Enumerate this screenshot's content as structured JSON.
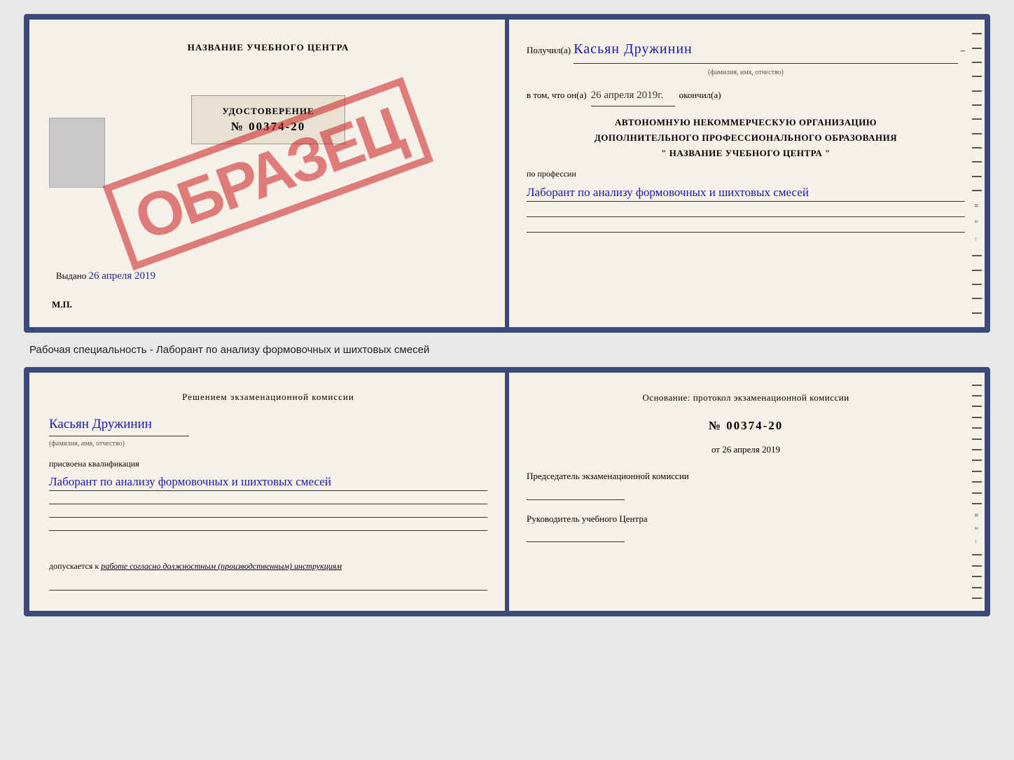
{
  "top_card": {
    "left": {
      "title": "НАЗВАНИЕ УЧЕБНОГО ЦЕНТРА",
      "stamp": "ОБРАЗЕЦ",
      "udost_label": "УДОСТОВЕРЕНИЕ",
      "udost_number": "№ 00374-20",
      "vydano_label": "Выдано",
      "vydano_date": "26 апреля 2019",
      "mp_label": "М.П."
    },
    "right": {
      "poluchil_label": "Получил(а)",
      "fio_name": "Касьян Дружинин",
      "fio_sub": "(фамилия, имя, отчество)",
      "vtom_label": "в том, что он(а)",
      "vtom_date": "26 апреля 2019г.",
      "okonchil_label": "окончил(а)",
      "org_line1": "АВТОНОМНУЮ НЕКОММЕРЧЕСКУЮ ОРГАНИЗАЦИЮ",
      "org_line2": "ДОПОЛНИТЕЛЬНОГО ПРОФЕССИОНАЛЬНОГО ОБРАЗОВАНИЯ",
      "org_name": "\" НАЗВАНИЕ УЧЕБНОГО ЦЕНТРА \"",
      "prof_label": "по профессии",
      "prof_handwritten": "Лаборант по анализу формовочных и шихтовых смесей"
    }
  },
  "specialty_label": "Рабочая специальность - Лаборант по анализу формовочных и шихтовых смесей",
  "bottom_card": {
    "left": {
      "heading": "Решением экзаменационной комиссии",
      "fio": "Касьян Дружинин",
      "fio_sub": "(фамилия, имя, отчество)",
      "prisvoena": "присвоена квалификация",
      "kvali": "Лаборант по анализу формовочных и шихтовых смесей",
      "dopusk_label": "допускается к",
      "dopusk_text": "работе согласно должностным (производственным) инструкциям"
    },
    "right": {
      "osnov_label": "Основание: протокол экзаменационной комиссии",
      "number": "№ 00374-20",
      "ot_prefix": "от",
      "ot_date": "26 апреля 2019",
      "predsedatel_label": "Председатель экзаменационной комиссии",
      "rukovod_label": "Руководитель учебного Центра"
    }
  }
}
